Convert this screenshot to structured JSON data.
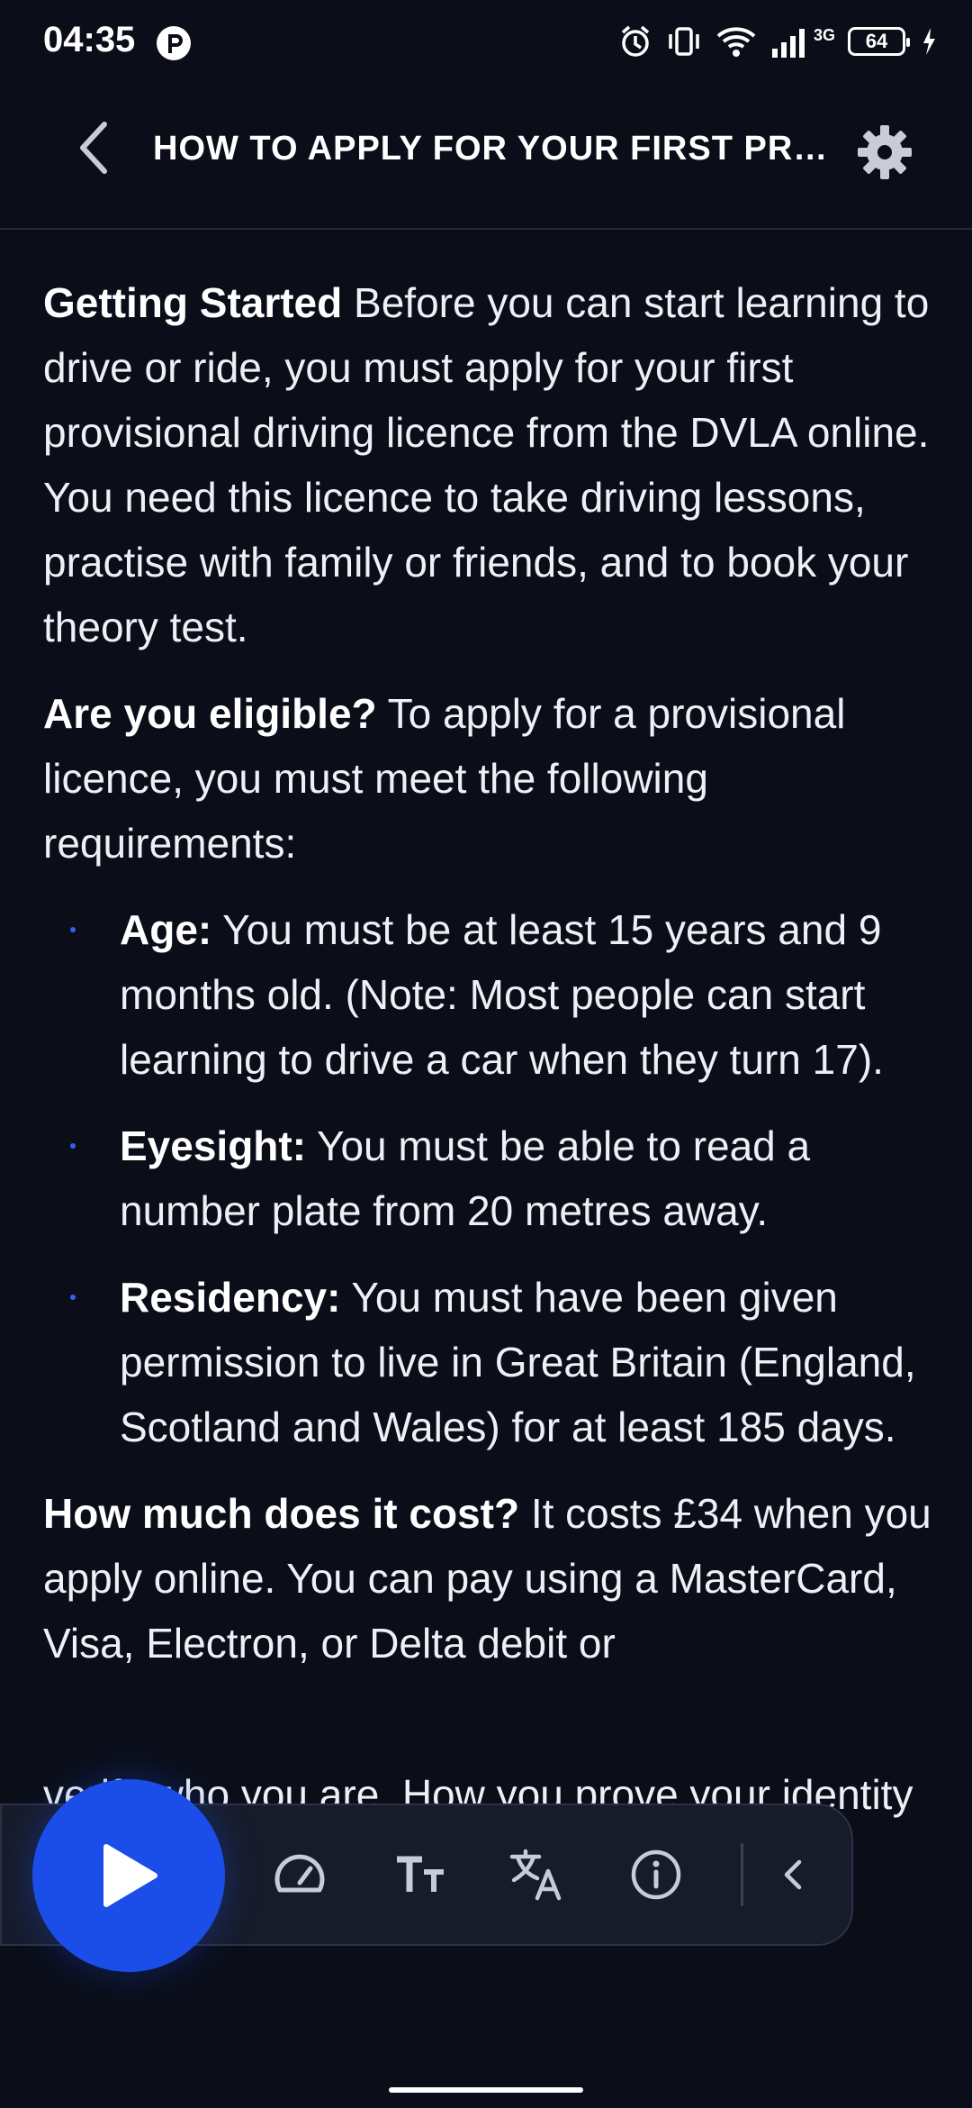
{
  "status_bar": {
    "time": "04:35",
    "network_type": "3G",
    "battery_level": "64"
  },
  "header": {
    "title": "HOW TO APPLY FOR YOUR FIRST PROVISIONAL DRIVING LICENCE"
  },
  "content": {
    "p1": {
      "bold": "Getting Started",
      "text": " Before you can start learning to drive or ride, you must apply for your first provisional driving licence from the DVLA online. You need this licence to take driving lessons, practise with family or friends, and to book your theory test."
    },
    "p2": {
      "bold": "Are you eligible?",
      "text": " To apply for a provisional licence, you must meet the following requirements:"
    },
    "requirements": [
      {
        "bold": "Age:",
        "text": " You must be at least 15 years and 9 months old. (Note: Most people can start learning to drive a car when they turn 17)."
      },
      {
        "bold": "Eyesight:",
        "text": " You must be able to read a number plate from 20 metres away."
      },
      {
        "bold": "Residency:",
        "text": " You must have been given permission to live in Great Britain (England, Scotland and Wales) for at least 185 days."
      }
    ],
    "p3": {
      "bold": "How much does it cost?",
      "text": " It costs £34 when you apply online. You can pay using a MasterCard, Visa, Electron, or Delta debit or"
    },
    "p4_visible": "verify who you are. How you prove your identity depends on the documents you"
  },
  "player": {
    "icons": [
      "play-icon",
      "speedometer-icon",
      "text-size-icon",
      "translate-icon",
      "info-icon",
      "chevron-left-icon"
    ]
  },
  "colors": {
    "background": "#0b0e19",
    "accent": "#1b4de8",
    "bullet": "#2f62f0"
  }
}
